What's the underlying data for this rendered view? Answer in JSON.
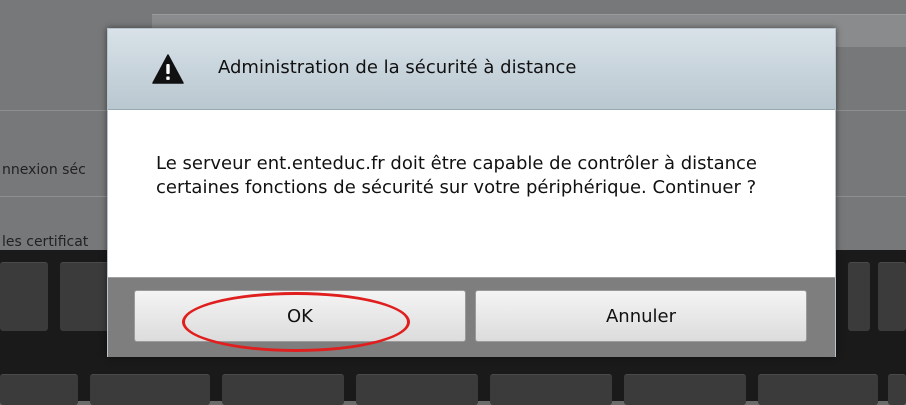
{
  "background": {
    "labels": [
      "nnexion séc",
      "les certificat"
    ]
  },
  "dialog": {
    "title": "Administration de la sécurité à distance",
    "icon": "warning-icon",
    "message": "Le serveur ent.enteduc.fr doit être capable de contrôler à distance certaines fonctions de sécurité sur votre périphérique. Continuer ?",
    "buttons": {
      "ok": "OK",
      "cancel": "Annuler"
    }
  },
  "colors": {
    "highlight": "#e01e1e",
    "header": "#c8d4dc"
  }
}
